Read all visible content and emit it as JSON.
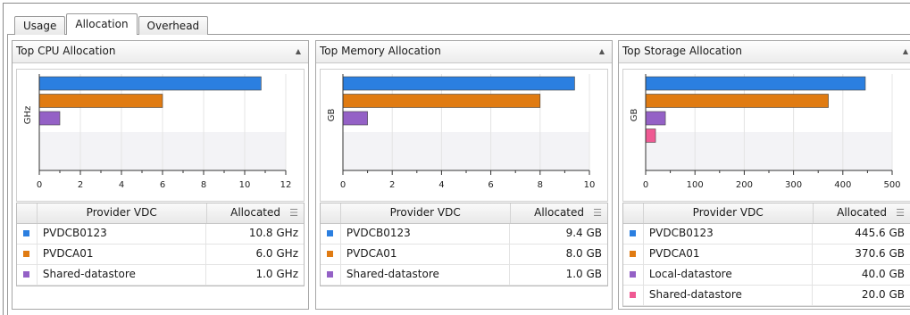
{
  "tabs": [
    {
      "label": "Usage",
      "active": false
    },
    {
      "label": "Allocation",
      "active": true
    },
    {
      "label": "Overhead",
      "active": false
    }
  ],
  "colors": {
    "blue": "#2b7fe0",
    "orange": "#e07b12",
    "purple": "#9461c6",
    "pink": "#ef5a93"
  },
  "panels": [
    {
      "title": "Top CPU Allocation",
      "collapse_icon": "chevron-up-icon",
      "table": {
        "headers": [
          "Provider VDC",
          "Allocated"
        ],
        "rows": [
          {
            "name": "PVDCB0123",
            "value": "10.8 GHz",
            "color": "#2b7fe0"
          },
          {
            "name": "PVDCA01",
            "value": "6.0 GHz",
            "color": "#e07b12"
          },
          {
            "name": "Shared-datastore",
            "value": "1.0 GHz",
            "color": "#9461c6"
          }
        ]
      }
    },
    {
      "title": "Top Memory Allocation",
      "collapse_icon": "chevron-up-icon",
      "table": {
        "headers": [
          "Provider VDC",
          "Allocated"
        ],
        "rows": [
          {
            "name": "PVDCB0123",
            "value": "9.4 GB",
            "color": "#2b7fe0"
          },
          {
            "name": "PVDCA01",
            "value": "8.0 GB",
            "color": "#e07b12"
          },
          {
            "name": "Shared-datastore",
            "value": "1.0 GB",
            "color": "#9461c6"
          }
        ]
      }
    },
    {
      "title": "Top Storage Allocation",
      "collapse_icon": "chevron-up-icon",
      "table": {
        "headers": [
          "Provider VDC",
          "Allocated"
        ],
        "rows": [
          {
            "name": "PVDCB0123",
            "value": "445.6 GB",
            "color": "#2b7fe0"
          },
          {
            "name": "PVDCA01",
            "value": "370.6 GB",
            "color": "#e07b12"
          },
          {
            "name": "Local-datastore",
            "value": "40.0 GB",
            "color": "#9461c6"
          },
          {
            "name": "Shared-datastore",
            "value": "20.0 GB",
            "color": "#ef5a93"
          }
        ]
      }
    }
  ],
  "chart_data": [
    {
      "type": "bar",
      "orientation": "horizontal",
      "categories": [
        "PVDCB0123",
        "PVDCA01",
        "Shared-datastore"
      ],
      "values": [
        10.8,
        6.0,
        1.0
      ],
      "colors": [
        "#2b7fe0",
        "#e07b12",
        "#9461c6"
      ],
      "ylabel": "GHz",
      "xlim": [
        0,
        12
      ],
      "ticks": [
        0,
        2,
        4,
        6,
        8,
        10,
        12
      ],
      "grid": true
    },
    {
      "type": "bar",
      "orientation": "horizontal",
      "categories": [
        "PVDCB0123",
        "PVDCA01",
        "Shared-datastore"
      ],
      "values": [
        9.4,
        8.0,
        1.0
      ],
      "colors": [
        "#2b7fe0",
        "#e07b12",
        "#9461c6"
      ],
      "ylabel": "GB",
      "xlim": [
        0,
        10
      ],
      "ticks": [
        0,
        2,
        4,
        6,
        8,
        10
      ],
      "grid": true
    },
    {
      "type": "bar",
      "orientation": "horizontal",
      "categories": [
        "PVDCB0123",
        "PVDCA01",
        "Local-datastore",
        "Shared-datastore"
      ],
      "values": [
        445.6,
        370.6,
        40.0,
        20.0
      ],
      "colors": [
        "#2b7fe0",
        "#e07b12",
        "#9461c6",
        "#ef5a93"
      ],
      "ylabel": "GB",
      "xlim": [
        0,
        500
      ],
      "ticks": [
        0,
        100,
        200,
        300,
        400,
        500
      ],
      "grid": true
    }
  ]
}
